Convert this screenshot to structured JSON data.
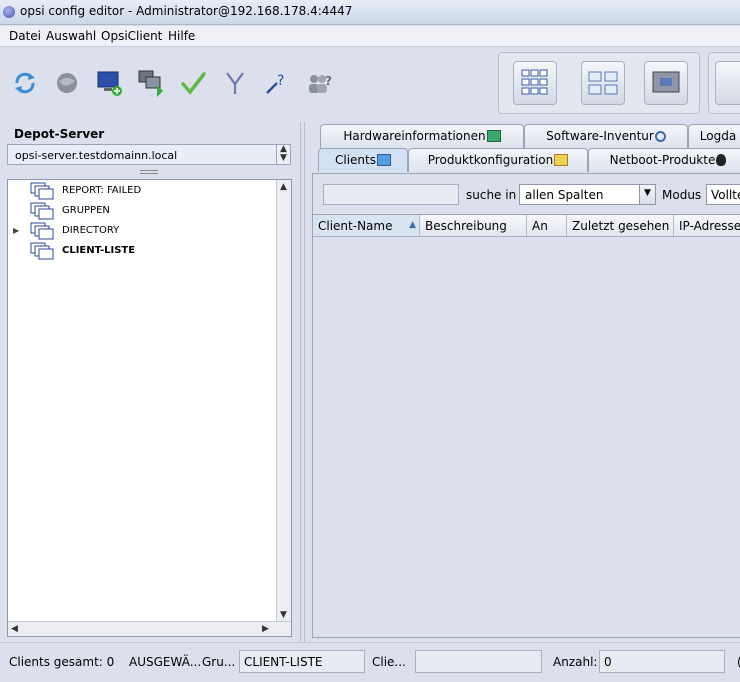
{
  "window": {
    "title": "opsi config editor - Administrator@192.168.178.4:4447"
  },
  "menu": {
    "items": [
      "Datei",
      "Auswahl",
      "OpsiClient",
      "Hilfe"
    ]
  },
  "depot": {
    "label": "Depot-Server",
    "value": "opsi-server.testdomainn.local"
  },
  "tree": {
    "items": [
      {
        "label": "REPORT: FAILED",
        "expandable": false,
        "bold": false
      },
      {
        "label": "GRUPPEN",
        "expandable": false,
        "bold": false
      },
      {
        "label": "DIRECTORY",
        "expandable": true,
        "bold": false
      },
      {
        "label": "CLIENT-LISTE",
        "expandable": false,
        "bold": true
      }
    ]
  },
  "tabs": {
    "row1": [
      "Hardwareinformationen",
      "Software-Inventur",
      "Logda"
    ],
    "row2": [
      "Clients",
      "Produktkonfiguration",
      "Netboot-Produkte"
    ]
  },
  "filter": {
    "search_value": "",
    "suche_in_label": "suche in",
    "column_select": "allen Spalten",
    "modus_label": "Modus",
    "modus_value": "Volltex"
  },
  "table": {
    "columns": [
      "Client-Name",
      "Beschreibung",
      "An",
      "Zuletzt gesehen",
      "IP-Adresse"
    ],
    "rows": []
  },
  "status": {
    "clients_total": "Clients gesamt: 0",
    "selected_label": "AUSGEWÄ...",
    "group_label": "Gru...",
    "group_value": "CLIENT-LISTE",
    "client_label": "Clie...",
    "client_value": "",
    "count_label": "Anzahl:",
    "count_value": "0",
    "trailing": "("
  },
  "colors": {
    "background": "#dce0ec",
    "active_tab": "#d2e1f4"
  }
}
